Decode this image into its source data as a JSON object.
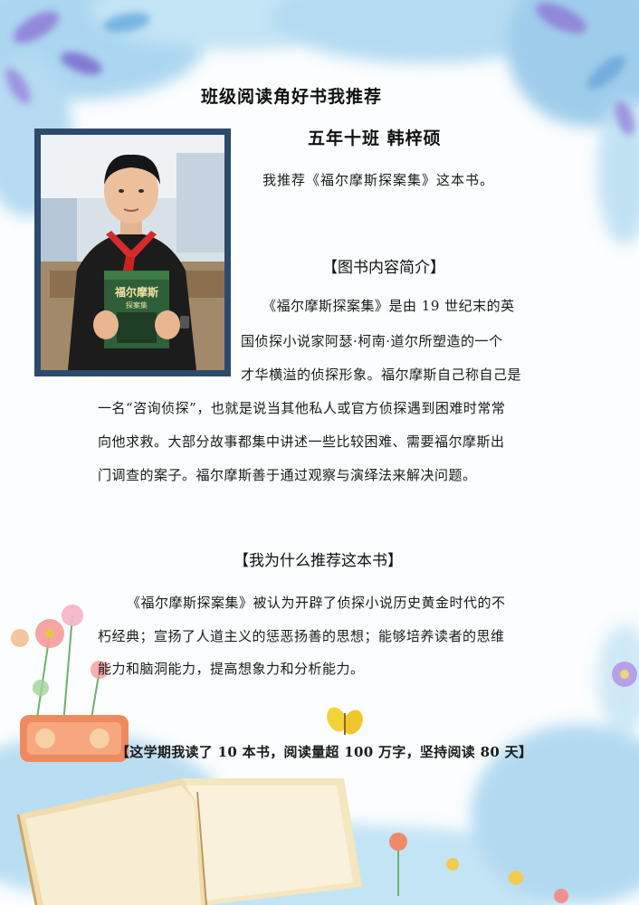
{
  "page": {
    "title": "班级阅读角好书我推荐",
    "author": "五年十班  韩梓硕",
    "recommend_sentence": "我推荐《福尔摩斯探案集》这本书。",
    "book_cover_text": "福尔摩斯",
    "book_cover_subtext": "探案集",
    "section_intro": {
      "heading": "【图书内容简介】",
      "lines": [
        "《福尔摩斯探案集》是由 19 世纪末的英",
        "国侦探小说家阿瑟·柯南·道尔所塑造的一个",
        "才华横溢的侦探形象。福尔摩斯自己称自己是",
        "一名“咨询侦探”，也就是说当其他私人或官方侦探遇到困难时常常",
        "向他求救。大部分故事都集中讲述一些比较困难、需要福尔摩斯出",
        "门调查的案子。福尔摩斯善于通过观察与演绎法来解决问题。"
      ]
    },
    "section_why": {
      "heading": "【我为什么推荐这本书】",
      "lines": [
        "《福尔摩斯探案集》被认为开辟了侦探小说历史黄金时代的不",
        "朽经典；宣扬了人道主义的惩恶扬善的思想；能够培养读者的思维",
        "能力和脑洞能力，提高想象力和分析能力。"
      ]
    },
    "stats_line": "【这学期我读了 10 本书，阅读量超 100 万字，坚持阅读 80 天】"
  },
  "colors": {
    "photo_border": "#2d4a6d",
    "watercolor_blue": "#8ec5e8",
    "watercolor_purple": "#9f8fe0",
    "book_page": "#f4e6bf",
    "butterfly": "#f3d23a"
  }
}
